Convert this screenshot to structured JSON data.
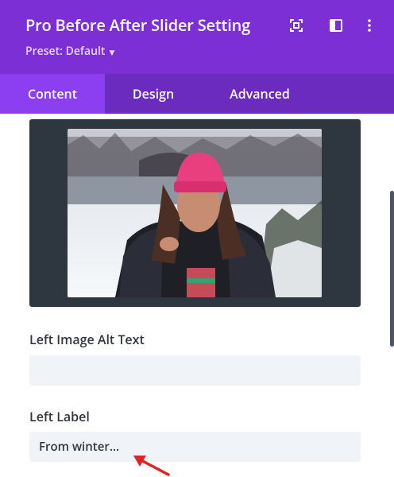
{
  "header": {
    "title": "Pro Before After Slider Setting",
    "preset_label": "Preset: Default",
    "icons": [
      "focus-icon",
      "sidebar-toggle-icon",
      "more-options-icon"
    ]
  },
  "tabs": [
    {
      "label": "Content",
      "active": true
    },
    {
      "label": "Design",
      "active": false
    },
    {
      "label": "Advanced",
      "active": false
    }
  ],
  "image_preview": {
    "alt": "Woman in pink beanie and fur coat in snowy park"
  },
  "fields": {
    "left_image_alt_text": {
      "label": "Left Image Alt Text",
      "value": ""
    },
    "left_label": {
      "label": "Left Label",
      "value": "From winter..."
    }
  },
  "colors": {
    "header_bg": "#7b2fd4",
    "tab_active": "#8c3ff0",
    "annotation_arrow": "#e02424"
  }
}
